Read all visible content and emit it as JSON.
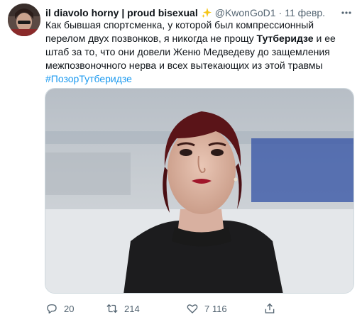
{
  "tweet": {
    "display_name": "il diavolo horny | proud bisexual",
    "handle": "@KwonGoD1",
    "separator": "·",
    "date": "11 февр.",
    "hashtag": "#ПозорТутберидзе",
    "text_part1": "Как бывшая спортсменка, у которой был компрессионный перелом двух позвонков, я никогда не прощу ",
    "text_bold": "Тутберидзе",
    "text_part2": " и ее штаб за то, что они довели Женю Медведеву до защемления межпозвоночного нерва и всех вытекающих из этой травмы"
  },
  "actions": {
    "reply_count": "20",
    "retweet_count": "214",
    "like_count": "7 116"
  },
  "colors": {
    "link": "#1d9bf0",
    "secondary_text": "#536471",
    "primary_text": "#0f1419",
    "sparkle": "#f5c518"
  },
  "icons": [
    "sparkle-icon",
    "more-icon",
    "reply-icon",
    "retweet-icon",
    "like-icon",
    "share-icon"
  ]
}
